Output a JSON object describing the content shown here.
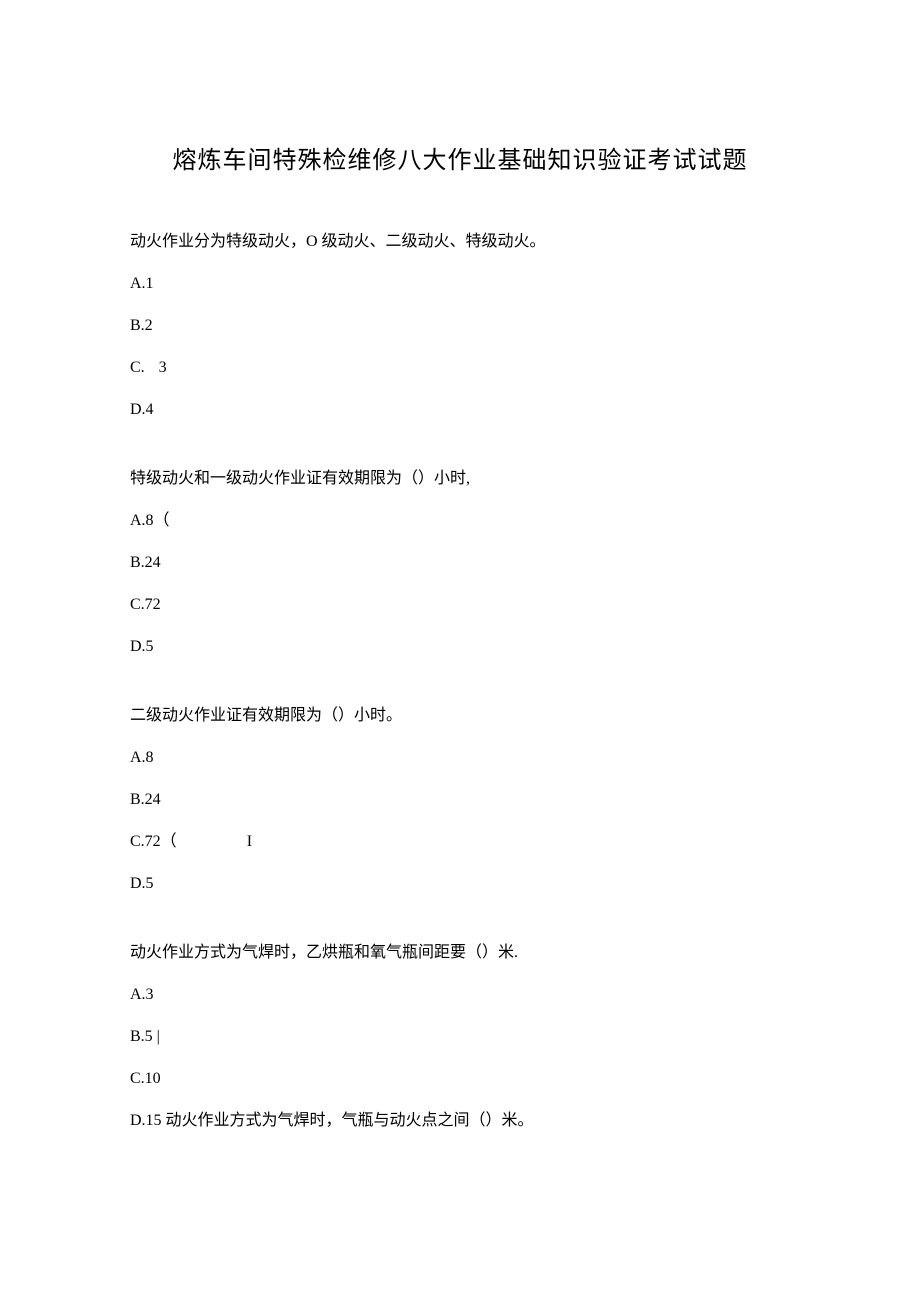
{
  "title": "熔炼车间特殊检维修八大作业基础知识验证考试试题",
  "questions": [
    {
      "text": "动火作业分为特级动火，O 级动火、二级动火、特级动火。",
      "options": [
        "A.1",
        "B.2",
        "C.   3",
        "D.4"
      ]
    },
    {
      "text": "特级动火和一级动火作业证有效期限为（）小时,",
      "options": [
        "A.8（",
        "B.24",
        "C.72",
        "D.5"
      ]
    },
    {
      "text": "二级动火作业证有效期限为（）小时。",
      "options": [
        "A.8",
        "B.24",
        "C.72（",
        "D.5"
      ],
      "extra_mark": "I"
    },
    {
      "text": "动火作业方式为气焊时，乙烘瓶和氧气瓶间距要（）米.",
      "options": [
        "A.3",
        "B.5 |",
        "C.10",
        "D.15 动火作业方式为气焊时，气瓶与动火点之间（）米。"
      ]
    }
  ]
}
